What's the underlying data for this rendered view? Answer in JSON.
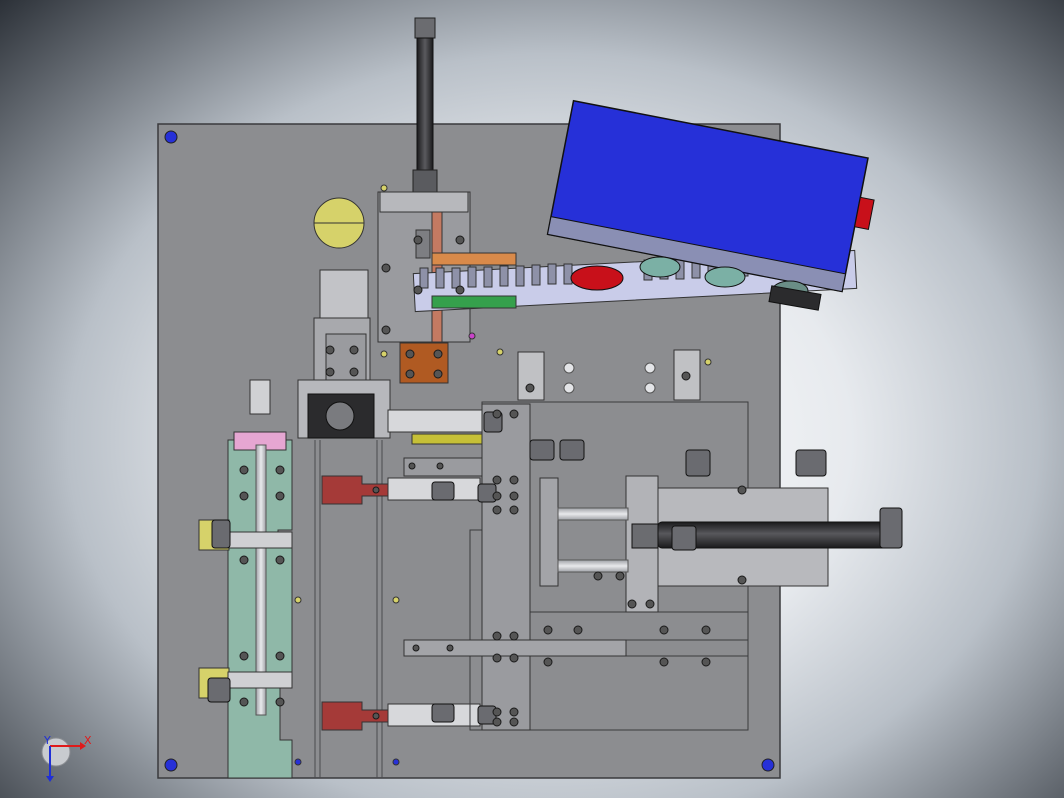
{
  "view": {
    "type": "CAD assembly top view",
    "colors": {
      "background_dark": "#2c3138",
      "plate": "#8c8d90",
      "plate_edge": "#3a3a3d",
      "gauge_body": "#2630d8",
      "rail_light": "#c9cce9",
      "teal_part": "#8fb8a8",
      "rust_part": "#b05a22",
      "red_part": "#c8101a",
      "maroon_part": "#a53a38",
      "yellow_part": "#d6d26a",
      "green_part": "#35a04c",
      "cylinder_rod": "#2b2b2d",
      "steel": "#c0c1c4"
    },
    "icons": [
      "hole-icon",
      "fitting-icon",
      "screw-icon"
    ]
  },
  "triad": {
    "x_label": "X",
    "y_label": "Y",
    "x_color": "#e01a1a",
    "y_color": "#1f2fd6"
  }
}
